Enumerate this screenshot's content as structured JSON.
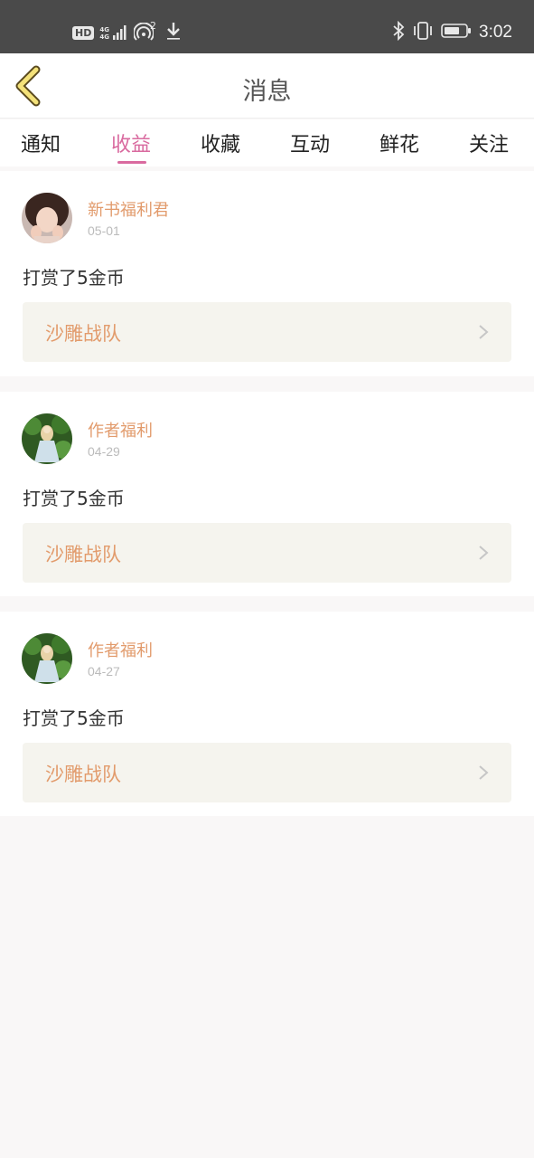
{
  "status_bar": {
    "hd": "HD",
    "network_top": "4G",
    "network_bottom": "4G",
    "wifi_sup": "2",
    "time": "3:02"
  },
  "header": {
    "title": "消息",
    "back_icon": "chevron-left-icon"
  },
  "tabs": [
    {
      "label": "通知"
    },
    {
      "label": "收益"
    },
    {
      "label": "收藏"
    },
    {
      "label": "互动"
    },
    {
      "label": "鲜花"
    },
    {
      "label": "关注"
    }
  ],
  "active_tab": "收益",
  "colors": {
    "accent_pink": "#d96a9f",
    "name_orange": "#e29b6c",
    "status_bar": "#4a4a4a",
    "link_bg": "#f5f4ee"
  },
  "messages": [
    {
      "name": "新书福利君",
      "date": "05-01",
      "text": "打赏了5金币",
      "link": "沙雕战队",
      "avatar": "girl-portrait-avatar"
    },
    {
      "name": "作者福利",
      "date": "04-29",
      "text": "打赏了5金币",
      "link": "沙雕战队",
      "avatar": "forest-doll-avatar"
    },
    {
      "name": "作者福利",
      "date": "04-27",
      "text": "打赏了5金币",
      "link": "沙雕战队",
      "avatar": "forest-doll-avatar"
    }
  ]
}
